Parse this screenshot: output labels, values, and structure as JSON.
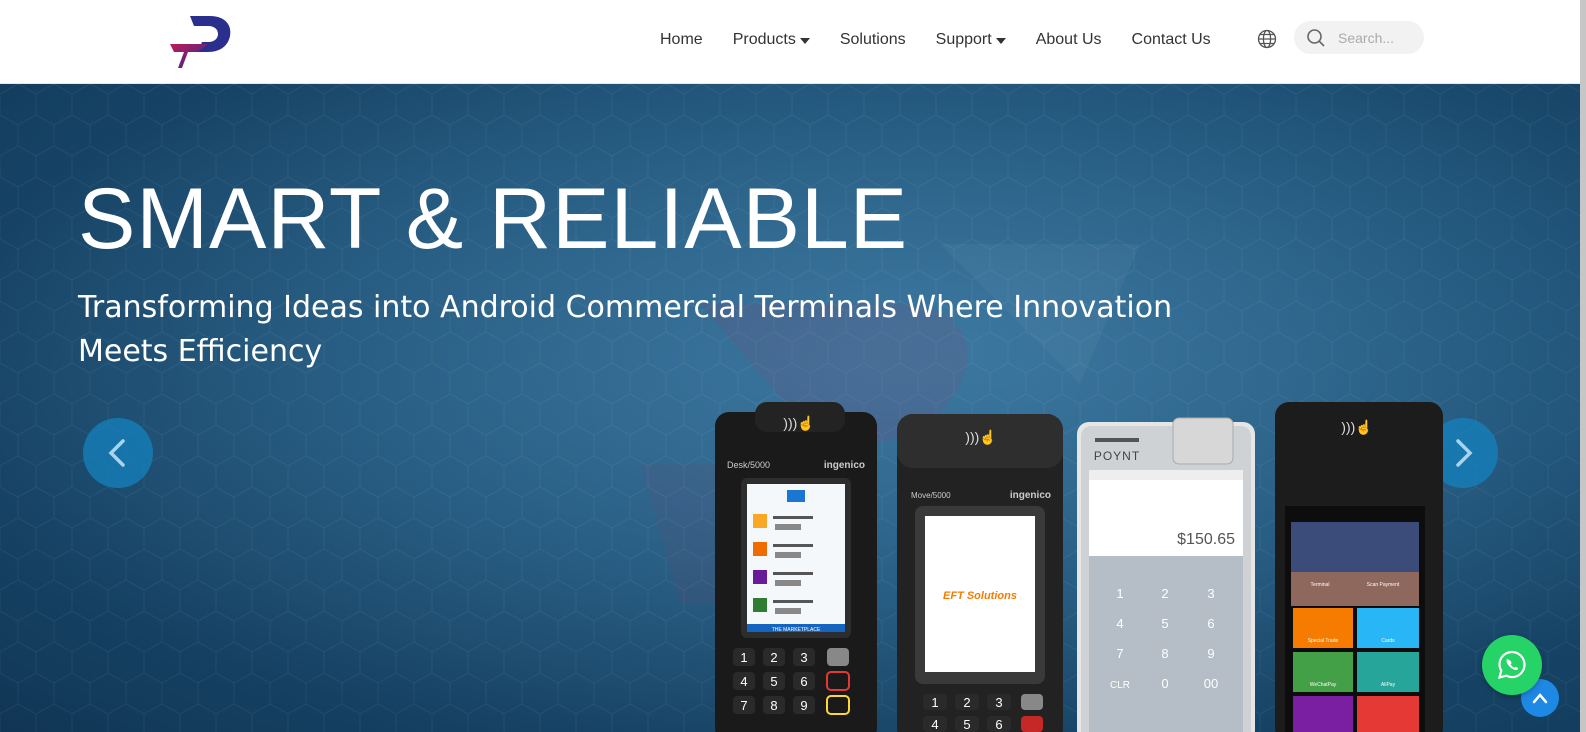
{
  "header": {
    "logo_name": "d-logo",
    "nav": [
      {
        "label": "Home",
        "dropdown": false
      },
      {
        "label": "Products",
        "dropdown": true
      },
      {
        "label": "Solutions",
        "dropdown": false
      },
      {
        "label": "Support",
        "dropdown": true
      },
      {
        "label": "About Us",
        "dropdown": false
      },
      {
        "label": "Contact Us",
        "dropdown": false
      }
    ],
    "language_icon": "globe-icon",
    "search": {
      "placeholder": "Search...",
      "value": "",
      "icon": "search-icon"
    }
  },
  "hero": {
    "title": "SMART & RELIABLE",
    "subtitle": "Transforming Ideas into Android Commercial Terminals Where Innovation Meets Efficiency",
    "prev_icon": "chevron-left-icon",
    "next_icon": "chevron-right-icon",
    "devices": [
      {
        "brand": "Desk/5000",
        "maker": "ingenico",
        "screen_title": "THE MARKETPLACE"
      },
      {
        "brand": "Move/5000",
        "maker": "ingenico",
        "screen_text": "EFT Solutions"
      },
      {
        "brand": "POYNT",
        "amount": "$150.65",
        "keys": [
          "1",
          "2",
          "3",
          "4",
          "5",
          "6",
          "7",
          "8",
          "9",
          "CLR",
          "0",
          "00"
        ]
      },
      {
        "brand": "",
        "tiles": [
          "Terminal",
          "Scan Payment",
          "Special Trade",
          "Cards",
          "WeChatPay",
          "AliPay"
        ]
      }
    ],
    "desk_keys": [
      "1",
      "2",
      "3",
      "4",
      "5",
      "6",
      "7",
      "8",
      "9"
    ],
    "move_keys": [
      "1",
      "2",
      "3",
      "4",
      "5",
      "6"
    ]
  },
  "floating": {
    "back_to_top_icon": "chevron-up-icon",
    "whatsapp_icon": "whatsapp-icon"
  },
  "colors": {
    "accent_blue": "#1e88e5",
    "whatsapp_green": "#25d366",
    "hero_bg": "#1f5b86",
    "logo_blue": "#2a2e8c",
    "logo_magenta": "#c2185b"
  }
}
